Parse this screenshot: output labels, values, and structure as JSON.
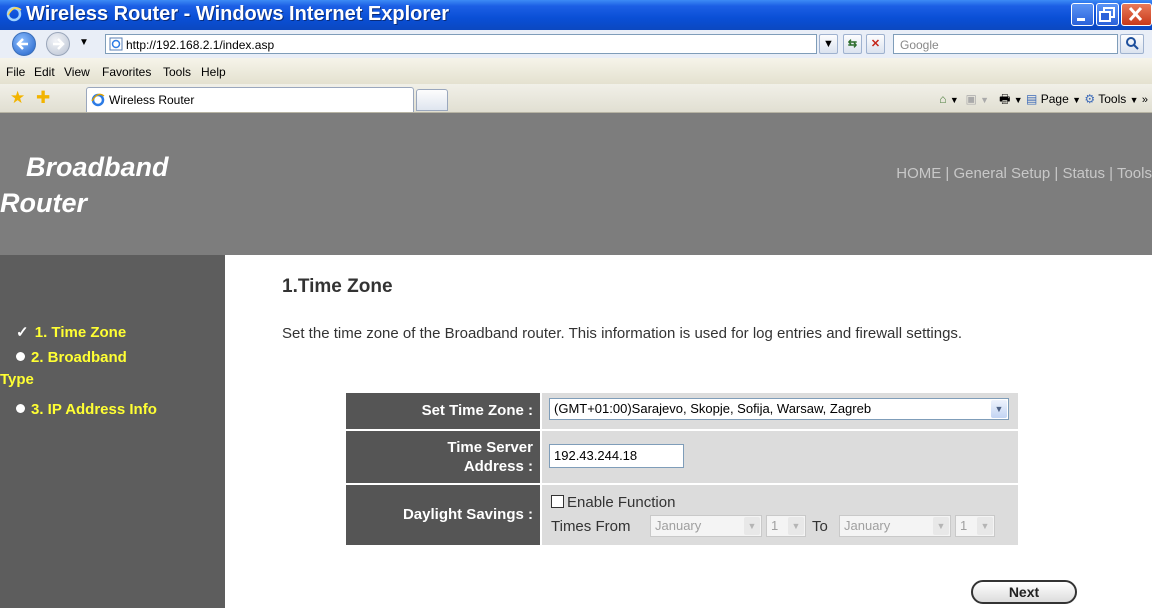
{
  "window": {
    "title": "Wireless Router - Windows Internet Explorer"
  },
  "browser": {
    "address": "http://192.168.2.1/index.asp",
    "search_placeholder": "Google",
    "menu": [
      "File",
      "Edit",
      "View",
      "Favorites",
      "Tools",
      "Help"
    ],
    "tab_title": "Wireless Router",
    "cmd_page": "Page",
    "cmd_tools": "Tools"
  },
  "header": {
    "logo_line1": "Broadband",
    "logo_line2": "Router",
    "nav": [
      "HOME",
      "General Setup",
      "Status",
      "Tools"
    ]
  },
  "sidebar": {
    "items": [
      {
        "label": "1. Time Zone",
        "state": "current"
      },
      {
        "label": "2. Broadband",
        "label2": "Type",
        "state": "pending"
      },
      {
        "label": "3. IP Address Info",
        "state": "pending"
      }
    ]
  },
  "main": {
    "title": "1.Time Zone",
    "description": "Set the time zone of the Broadband router. This information is used for log entries and firewall settings."
  },
  "form": {
    "time_zone_label": "Set Time Zone :",
    "time_zone_value": "(GMT+01:00)Sarajevo, Skopje, Sofija, Warsaw, Zagreb",
    "time_server_label_1": "Time Server",
    "time_server_label_2": "Address :",
    "time_server_value": "192.43.244.18",
    "daylight_label": "Daylight Savings :",
    "enable_label": "Enable Function",
    "enable_checked": false,
    "times_from_label": "Times From",
    "from_month": "January",
    "from_day": "1",
    "to_label": "To",
    "to_month": "January",
    "to_day": "1"
  },
  "buttons": {
    "next": "Next"
  }
}
